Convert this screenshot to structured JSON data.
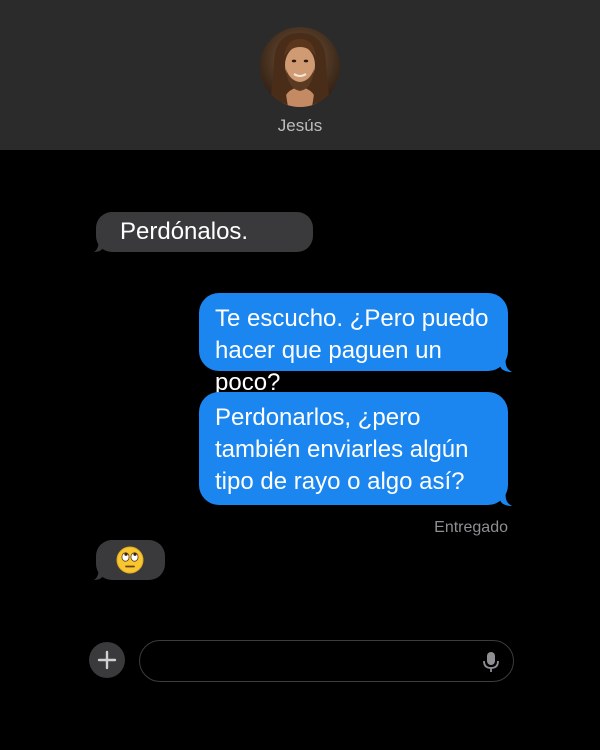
{
  "header": {
    "contact_name": "Jesús"
  },
  "messages": [
    {
      "direction": "incoming",
      "text": "Perdónalos."
    },
    {
      "direction": "outgoing",
      "lines": [
        "Te escucho. ¿Pero puedo",
        "hacer que paguen un poco?"
      ]
    },
    {
      "direction": "outgoing",
      "lines": [
        "Perdonarlos, ¿pero",
        "también enviarles algún",
        "tipo de rayo o algo así?"
      ]
    },
    {
      "direction": "incoming",
      "emoji": "face-with-rolling-eyes"
    }
  ],
  "status": {
    "delivered_label": "Entregado"
  },
  "composer": {
    "plus_icon": "plus-icon",
    "mic_icon": "microphone-icon",
    "value": ""
  },
  "colors": {
    "header_bg": "#2b2b2b",
    "background": "#000000",
    "incoming_bubble": "#3a3a3c",
    "outgoing_bubble": "#1b86f0",
    "status_text": "#8e8e93"
  }
}
